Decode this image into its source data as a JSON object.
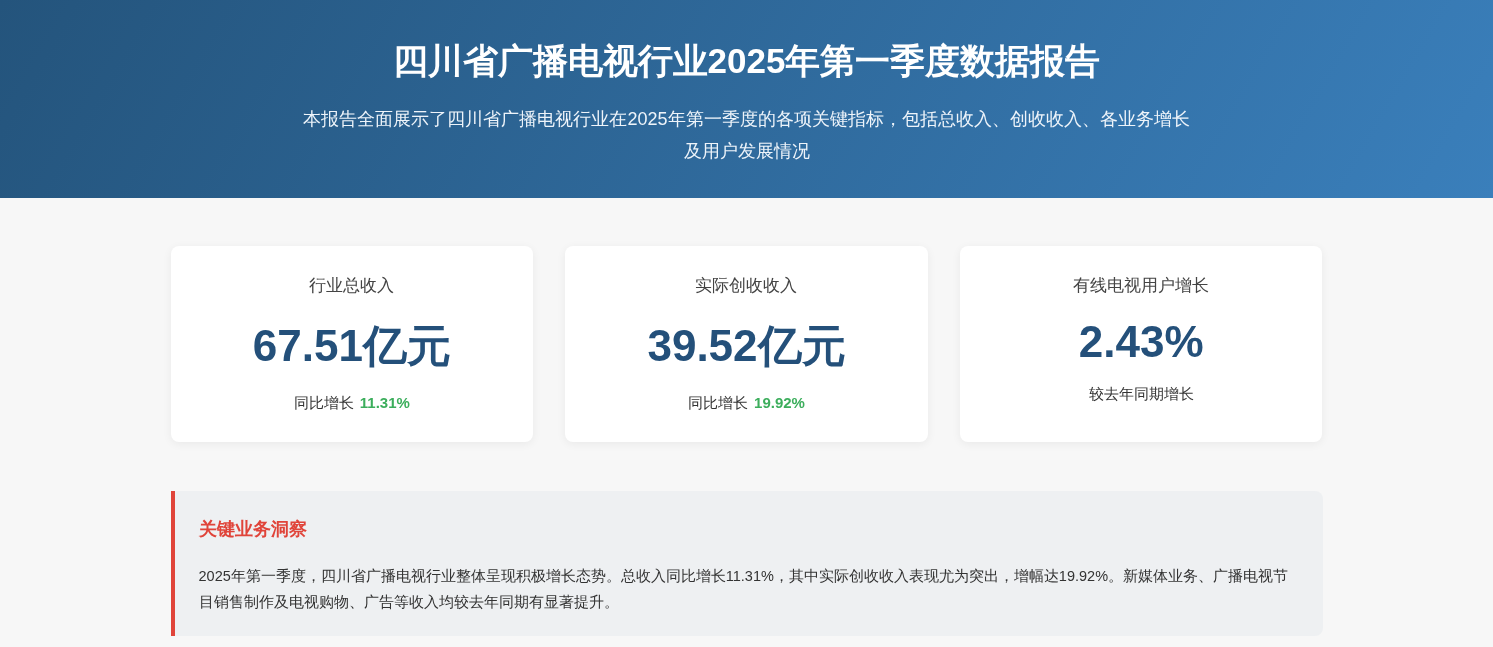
{
  "header": {
    "title": "四川省广播电视行业2025年第一季度数据报告",
    "subtitle": "本报告全面展示了四川省广播电视行业在2025年第一季度的各项关键指标，包括总收入、创收收入、各业务增长及用户发展情况"
  },
  "cards": [
    {
      "kind": "growth",
      "label": "行业总收入",
      "value": "67.51亿元",
      "note": "同比增长",
      "change": "11.31%"
    },
    {
      "kind": "growth",
      "label": "实际创收收入",
      "value": "39.52亿元",
      "note": "同比增长",
      "change": "19.92%"
    },
    {
      "kind": "note",
      "label": "有线电视用户增长",
      "value": "2.43%",
      "note": "较去年同期增长"
    }
  ],
  "insight": {
    "title": "关键业务洞察",
    "text": "2025年第一季度，四川省广播电视行业整体呈现积极增长态势。总收入同比增长11.31%，其中实际创收收入表现尤为突出，增幅达19.92%。新媒体业务、广播电视节目销售制作及电视购物、广告等收入均较去年同期有显著提升。"
  }
}
